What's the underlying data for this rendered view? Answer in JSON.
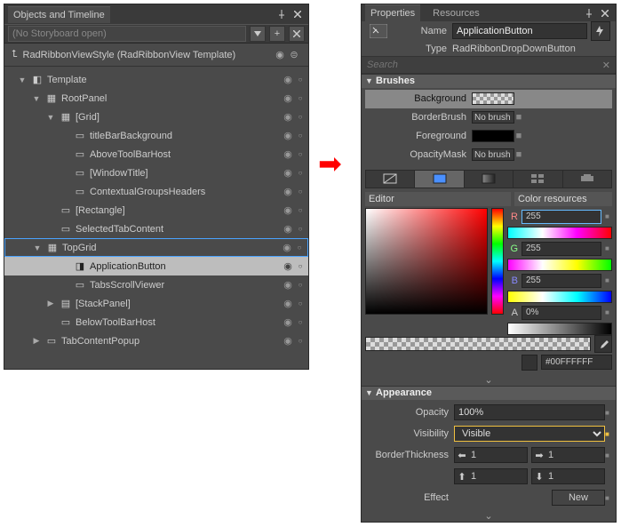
{
  "left": {
    "title": "Objects and Timeline",
    "storyboard": "(No Storyboard open)",
    "breadcrumb": "RadRibbonViewStyle (RadRibbonView Template)",
    "tree": [
      {
        "d": 0,
        "exp": "▼",
        "icon": "tpl",
        "label": "Template"
      },
      {
        "d": 1,
        "exp": "▼",
        "icon": "grid",
        "label": "RootPanel"
      },
      {
        "d": 2,
        "exp": "▼",
        "icon": "grid",
        "label": "[Grid]"
      },
      {
        "d": 3,
        "exp": "",
        "icon": "rect",
        "label": "titleBarBackground"
      },
      {
        "d": 3,
        "exp": "",
        "icon": "ctrl",
        "label": "AboveToolBarHost"
      },
      {
        "d": 3,
        "exp": "",
        "icon": "ctrl",
        "label": "[WindowTitle]"
      },
      {
        "d": 3,
        "exp": "",
        "icon": "ctrl",
        "label": "ContextualGroupsHeaders"
      },
      {
        "d": 2,
        "exp": "",
        "icon": "rect",
        "label": "[Rectangle]"
      },
      {
        "d": 2,
        "exp": "",
        "icon": "ctrl",
        "label": "SelectedTabContent"
      },
      {
        "d": 1,
        "exp": "▼",
        "icon": "grid",
        "label": "TopGrid",
        "highlight": true
      },
      {
        "d": 3,
        "exp": "",
        "icon": "btn",
        "label": "ApplicationButton",
        "selected": true
      },
      {
        "d": 3,
        "exp": "",
        "icon": "ctrl",
        "label": "TabsScrollViewer"
      },
      {
        "d": 2,
        "exp": "▶",
        "icon": "panel",
        "label": "[StackPanel]"
      },
      {
        "d": 2,
        "exp": "",
        "icon": "ctrl",
        "label": "BelowToolBarHost"
      },
      {
        "d": 1,
        "exp": "▶",
        "icon": "ctrl",
        "label": "TabContentPopup"
      }
    ]
  },
  "right": {
    "tab1": "Properties",
    "tab2": "Resources",
    "name_label": "Name",
    "name_value": "ApplicationButton",
    "type_label": "Type",
    "type_value": "RadRibbonDropDownButton",
    "search_placeholder": "Search",
    "brushes_hdr": "Brushes",
    "brushes": [
      {
        "label": "Background",
        "style": "checker",
        "sel": true
      },
      {
        "label": "BorderBrush",
        "text": "No brush"
      },
      {
        "label": "Foreground",
        "style": "black"
      },
      {
        "label": "OpacityMask",
        "text": "No brush"
      }
    ],
    "editor_label": "Editor",
    "color_res_label": "Color resources",
    "rgba": {
      "R": "255",
      "G": "255",
      "B": "255",
      "A": "0%"
    },
    "hex": "#00FFFFFF",
    "appearance_hdr": "Appearance",
    "opacity_label": "Opacity",
    "opacity_value": "100%",
    "visibility_label": "Visibility",
    "visibility_value": "Visible",
    "border_label": "BorderThickness",
    "thick": {
      "l": "1",
      "r": "1",
      "t": "1",
      "b": "1"
    },
    "effect_label": "Effect",
    "new_label": "New"
  }
}
